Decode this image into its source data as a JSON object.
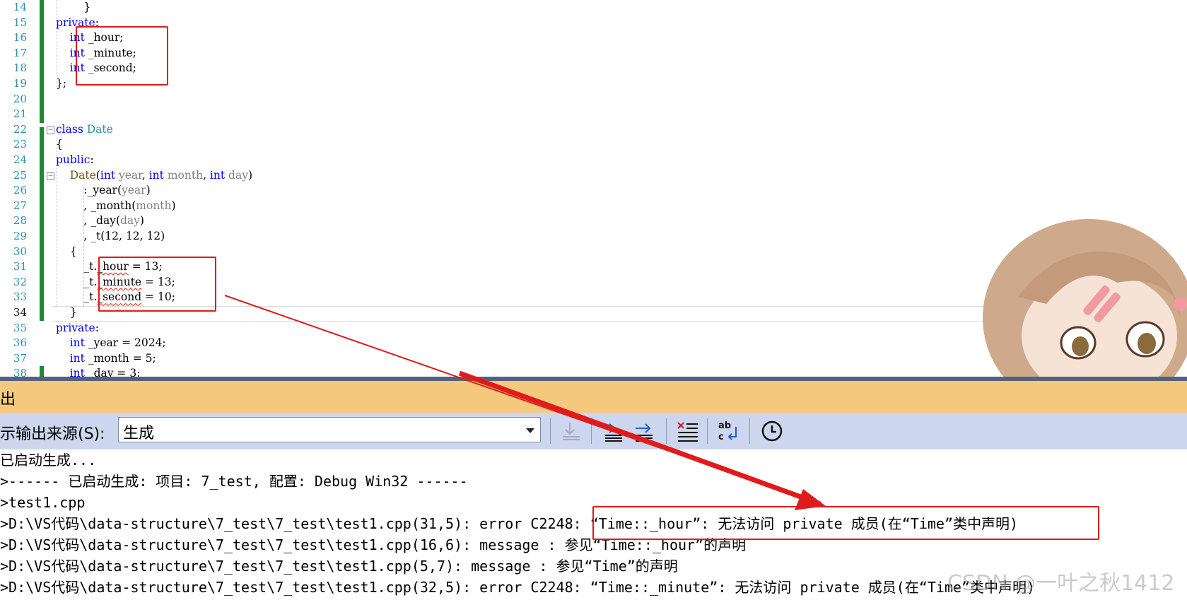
{
  "editor": {
    "lines": [
      {
        "n": "14",
        "code": "        }"
      },
      {
        "n": "15",
        "code": "private:"
      },
      {
        "n": "16",
        "code": "    int _hour;"
      },
      {
        "n": "17",
        "code": "    int _minute;"
      },
      {
        "n": "18",
        "code": "    int _second;"
      },
      {
        "n": "19",
        "code": "};"
      },
      {
        "n": "20",
        "code": ""
      },
      {
        "n": "21",
        "code": ""
      },
      {
        "n": "22",
        "code": "class Date"
      },
      {
        "n": "23",
        "code": "{"
      },
      {
        "n": "24",
        "code": "public:"
      },
      {
        "n": "25",
        "code": "    Date(int year, int month, int day)"
      },
      {
        "n": "26",
        "code": "        :_year(year)"
      },
      {
        "n": "27",
        "code": "        , _month(month)"
      },
      {
        "n": "28",
        "code": "        , _day(day)"
      },
      {
        "n": "29",
        "code": "        , _t(12, 12, 12)"
      },
      {
        "n": "30",
        "code": "    {"
      },
      {
        "n": "31",
        "code": "        _t._hour = 13;"
      },
      {
        "n": "32",
        "code": "        _t._minute = 13;"
      },
      {
        "n": "33",
        "code": "        _t._second = 10;"
      },
      {
        "n": "34",
        "code": "    }"
      },
      {
        "n": "35",
        "code": "private:"
      },
      {
        "n": "36",
        "code": "    int _year = 2024;"
      },
      {
        "n": "37",
        "code": "    int _month = 5;"
      },
      {
        "n": "38",
        "code": "    int _day = 3;"
      }
    ]
  },
  "output_panel": {
    "title": "出",
    "source_label": "示输出来源(S):",
    "source_value": "生成",
    "lines": [
      "已启动生成...",
      ">------ 已启动生成: 项目: 7_test, 配置: Debug Win32 ------",
      ">test1.cpp",
      ">D:\\VS代码\\data-structure\\7_test\\7_test\\test1.cpp(31,5): error C2248: “Time::_hour”: 无法访问 private 成员(在“Time”类中声明)",
      ">D:\\VS代码\\data-structure\\7_test\\7_test\\test1.cpp(16,6): message : 参见“Time::_hour”的声明",
      ">D:\\VS代码\\data-structure\\7_test\\7_test\\test1.cpp(5,7): message : 参见“Time”的声明",
      ">D:\\VS代码\\data-structure\\7_test\\7_test\\test1.cpp(32,5): error C2248: “Time::_minute”: 无法访问 private 成员(在“Time”类中声明)"
    ],
    "toolbar_icons": [
      "goto-prev-icon",
      "goto-next-message-icon",
      "goto-next-error-icon",
      "clear-all-icon",
      "word-wrap-icon",
      "clock-icon"
    ]
  },
  "watermark": "CSDN @一叶之秋1412",
  "colors": {
    "keyword": "#0000ff",
    "type": "#2b91af",
    "annotation_red": "#e01b1b",
    "title_bar": "#f4c97e",
    "toolbar_bg": "#cdd6ef"
  }
}
